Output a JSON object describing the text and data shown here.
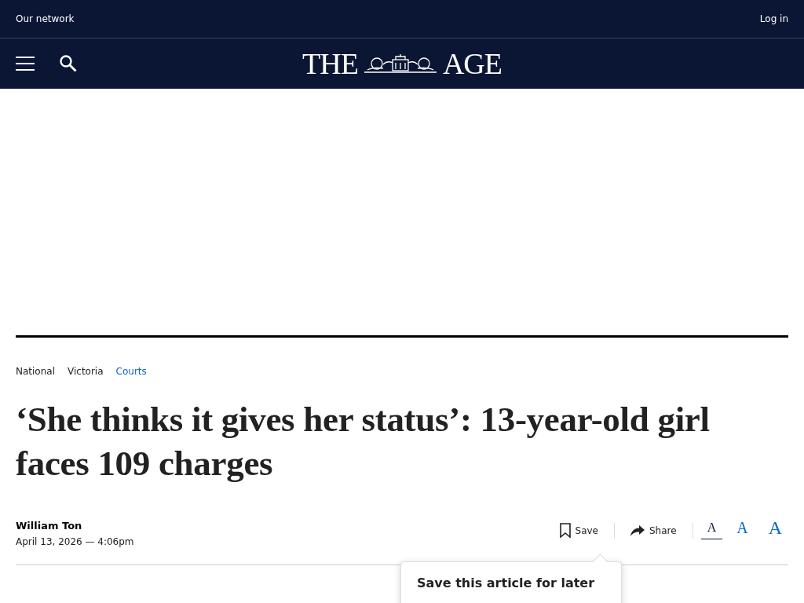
{
  "top_bar": {
    "network_link": "Our network",
    "login_link": "Log in"
  },
  "masthead": {
    "logo_left": "THE",
    "logo_right": "AGE"
  },
  "breadcrumbs": [
    {
      "label": "National",
      "selected": false
    },
    {
      "label": "Victoria",
      "selected": false
    },
    {
      "label": "Courts",
      "selected": true
    }
  ],
  "headline": "‘She thinks it gives her status’: 13-year-old girl faces 109 charges",
  "byline": {
    "author": "William Ton",
    "date": "April 13, 2026 — 4:06pm"
  },
  "actions": [
    {
      "kind": "save",
      "label": "Save"
    },
    {
      "kind": "share",
      "label": "Share"
    }
  ],
  "font_sizes": [
    {
      "kind": "small",
      "label": "A",
      "selected": true
    },
    {
      "kind": "medium",
      "label": "A",
      "selected": false
    },
    {
      "kind": "large",
      "label": "A",
      "selected": false
    }
  ],
  "save_popup": {
    "title": "Save this article for later"
  }
}
